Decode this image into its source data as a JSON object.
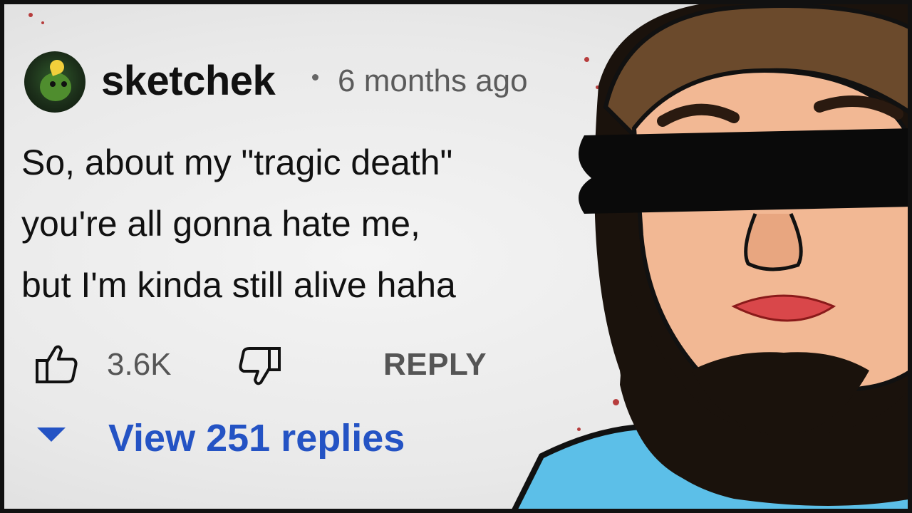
{
  "comment": {
    "author": "sketchek",
    "time_ago": "6 months ago",
    "lines": [
      "So, about my \"tragic death\"",
      "you're all gonna hate me,",
      "but I'm kinda still alive haha"
    ],
    "like_count": "3.6K",
    "reply_label": "REPLY",
    "view_replies_label": "View 251 replies"
  },
  "icons": {
    "like": "thumbs-up-icon",
    "dislike": "thumbs-down-icon",
    "expand": "caret-down-icon"
  },
  "colors": {
    "link_blue": "#2453c4",
    "muted_text": "#555555",
    "blood_red": "#a11111",
    "shirt_blue": "#5cbfe8"
  }
}
